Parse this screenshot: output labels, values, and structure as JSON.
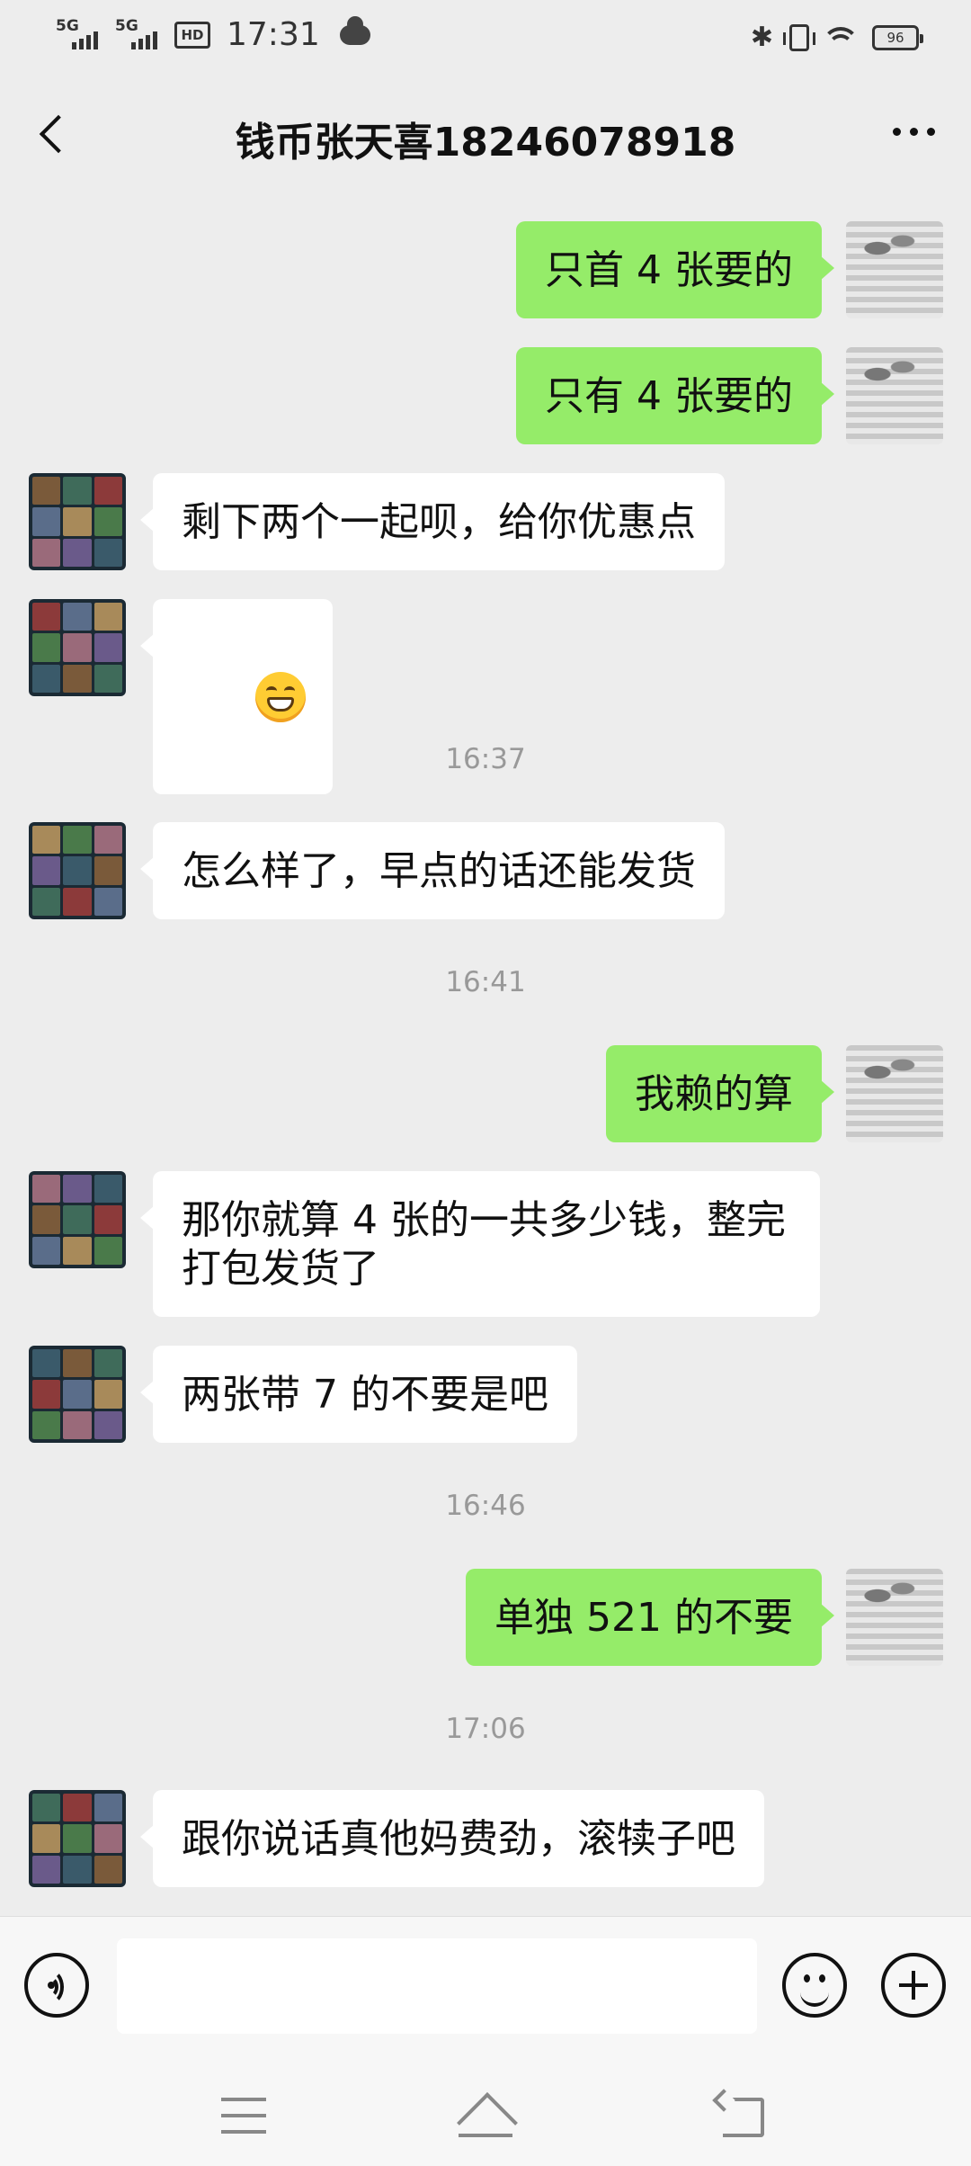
{
  "status_bar": {
    "time": "17:31",
    "network1": "5G",
    "network2": "5G",
    "hd_label": "HD",
    "battery": "96"
  },
  "header": {
    "title": "钱币张天喜18246078918"
  },
  "messages": [
    {
      "type": "text",
      "side": "self",
      "text": "只首 4 张要的"
    },
    {
      "type": "text",
      "side": "self",
      "text": "只有 4 张要的"
    },
    {
      "type": "text",
      "side": "other",
      "text": "剩下两个一起呗，给你优惠点"
    },
    {
      "type": "emoji",
      "side": "other",
      "emoji": "grinning-face"
    },
    {
      "type": "time",
      "text": "16:37"
    },
    {
      "type": "text",
      "side": "other",
      "text": "怎么样了，早点的话还能发货"
    },
    {
      "type": "time",
      "text": "16:41"
    },
    {
      "type": "text",
      "side": "self",
      "text": "我赖的算"
    },
    {
      "type": "text",
      "side": "other",
      "text": "那你就算 4 张的一共多少钱，整完\n打包发货了"
    },
    {
      "type": "text",
      "side": "other",
      "text": "两张带 7 的不要是吧"
    },
    {
      "type": "time",
      "text": "16:46"
    },
    {
      "type": "text",
      "side": "self",
      "text": "单独 521 的不要"
    },
    {
      "type": "time",
      "text": "17:06"
    },
    {
      "type": "text",
      "side": "other",
      "text": "跟你说话真他妈费劲，滚犊子吧"
    }
  ],
  "input_bar": {
    "value": "",
    "icons": [
      "voice-icon",
      "emoji-icon",
      "plus-icon"
    ]
  },
  "system_nav": {
    "icons": [
      "menu-icon",
      "home-icon",
      "back-icon"
    ]
  },
  "colors": {
    "background": "#ededed",
    "self_bubble": "#95ec69",
    "other_bubble": "#ffffff",
    "timestamp": "#999999"
  }
}
